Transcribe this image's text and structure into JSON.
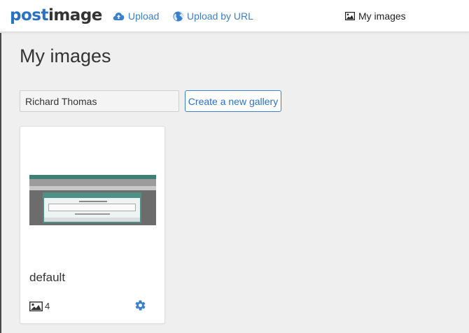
{
  "header": {
    "logo_part1": "post",
    "logo_part2": "image",
    "nav": {
      "upload_label": "Upload",
      "upload_icon": "cloud-upload-icon",
      "upload_url_label": "Upload by URL",
      "upload_url_icon": "globe-icon",
      "my_images_label": "My images",
      "my_images_icon": "image-icon"
    }
  },
  "main": {
    "title": "My images",
    "gallery_input_value": "Richard Thomas",
    "create_gallery_label": "Create a new gallery"
  },
  "galleries": [
    {
      "name": "default",
      "image_count": "4",
      "settings_icon": "gear-icon",
      "count_icon": "image-icon"
    }
  ],
  "colors": {
    "accent": "#3b80cf",
    "background": "#efefef",
    "card": "#ffffff"
  }
}
